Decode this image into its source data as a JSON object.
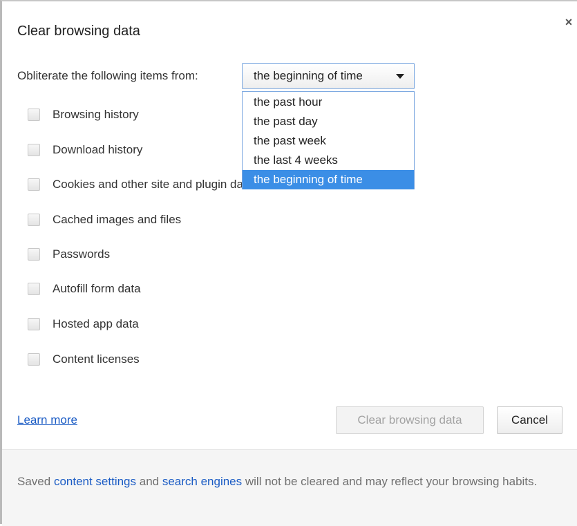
{
  "dialog": {
    "title": "Clear browsing data",
    "close_label": "×"
  },
  "time_range": {
    "label": "Obliterate the following items from:",
    "selected": "the beginning of time",
    "options": [
      "the past hour",
      "the past day",
      "the past week",
      "the last 4 weeks",
      "the beginning of time"
    ],
    "dropdown_open": true
  },
  "checkboxes": [
    {
      "label": "Browsing history",
      "checked": false
    },
    {
      "label": "Download history",
      "checked": false
    },
    {
      "label": "Cookies and other site and plugin data",
      "checked": false
    },
    {
      "label": "Cached images and files",
      "checked": false
    },
    {
      "label": "Passwords",
      "checked": false
    },
    {
      "label": "Autofill form data",
      "checked": false
    },
    {
      "label": "Hosted app data",
      "checked": false
    },
    {
      "label": "Content licenses",
      "checked": false
    }
  ],
  "actions": {
    "learn_more": "Learn more",
    "clear_label": "Clear browsing data",
    "clear_enabled": false,
    "cancel_label": "Cancel"
  },
  "footer": {
    "prefix": "Saved ",
    "link1": "content settings",
    "middle": " and ",
    "link2": "search engines",
    "suffix": " will not be cleared and may reflect your browsing habits."
  },
  "colors": {
    "link": "#1a5bc4",
    "selected_option": "#3b8ee6",
    "footer_bg": "#f5f5f5"
  }
}
